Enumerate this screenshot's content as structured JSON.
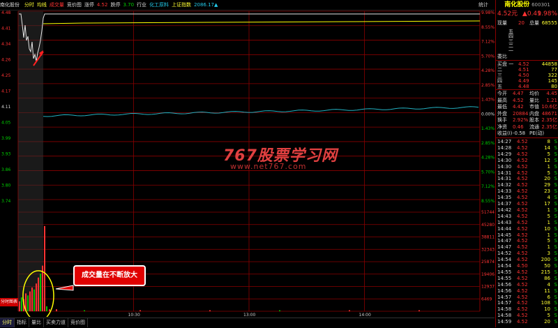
{
  "header": {
    "stock": "南化股份",
    "items": [
      {
        "label": "分时",
        "color": "#ffff33"
      },
      {
        "label": "均线",
        "color": "#ffff33"
      },
      {
        "label": "成交量",
        "color": "#ff3333"
      },
      {
        "label": "竞价图",
        "color": "#ddd"
      },
      {
        "label": "涨停",
        "color": "#ddd"
      },
      {
        "label": "4.52",
        "color": "#ff3333"
      },
      {
        "label": "跌停",
        "color": "#ddd"
      },
      {
        "label": "3.70",
        "color": "#00d000"
      },
      {
        "label": "行业",
        "color": "#ddd"
      },
      {
        "label": "化工原料",
        "color": "#22c8e8"
      },
      {
        "label": "上证指数",
        "color": "#ffff33"
      },
      {
        "label": "2086.17▲",
        "color": "#22c8e8"
      }
    ],
    "right_label": "统计"
  },
  "price_axis_left": [
    "4.48",
    "4.41",
    "4.34",
    "4.26",
    "4.25",
    "4.17",
    "4.11",
    "4.05",
    "3.99",
    "3.93",
    "3.86",
    "3.80",
    "3.74"
  ],
  "price_axis_right": [
    "9.98%",
    "8.55%",
    "7.12%",
    "5.70%",
    "4.28%",
    "2.85%",
    "1.43%",
    "0.00%",
    "1.43%",
    "2.85%",
    "4.28%",
    "5.70%",
    "7.12%",
    "8.55%"
  ],
  "volume_axis": [
    "51744",
    "45280",
    "38811",
    "32343",
    "25874",
    "19406",
    "12937",
    "6469"
  ],
  "time_axis": [
    "10:30",
    "13:00",
    "14:00"
  ],
  "watermark": {
    "line1": "767股票学习网",
    "line2": "www.net767.com"
  },
  "callout": "成交量在不断放大",
  "side_label": "分时图表",
  "bottom_tabs": [
    {
      "label": "分时",
      "active": true
    },
    {
      "label": "指标",
      "active": false
    },
    {
      "label": "量比",
      "active": false
    },
    {
      "label": "买卖力道",
      "active": false
    },
    {
      "label": "竞价图",
      "active": false
    }
  ],
  "quote": {
    "name": "南化股份",
    "code": "600301",
    "price": "4.52元",
    "change": "▲0.41",
    "pct": "9.98%",
    "xianliang_label": "现量",
    "xianliang": "20",
    "zongliang_label": "总量",
    "zongliang": "68555",
    "ask_labels": [
      "五",
      "四",
      "三",
      "二",
      "一"
    ],
    "weibi_label": "委比",
    "bids": [
      {
        "label": "买盘 一",
        "price": "4.52",
        "vol": "44858"
      },
      {
        "label": "二",
        "price": "4.51",
        "vol": "77"
      },
      {
        "label": "三",
        "price": "4.50",
        "vol": "322"
      },
      {
        "label": "四",
        "price": "4.49",
        "vol": "145"
      },
      {
        "label": "五",
        "price": "4.48",
        "vol": "80"
      }
    ],
    "stats": [
      {
        "l1": "今开",
        "v1": "4.47",
        "l2": "均价",
        "v2": "4.45"
      },
      {
        "l1": "最高",
        "v1": "4.52",
        "l2": "量比",
        "v2": "1.21"
      },
      {
        "l1": "最低",
        "v1": "4.42",
        "l2": "市值",
        "v2": "10.6亿"
      },
      {
        "l1": "外盘",
        "v1": "20884",
        "l2": "内盘",
        "v2": "48671"
      },
      {
        "l1": "换手",
        "v1": "2.92%",
        "l2": "股本",
        "v2": "2.35亿"
      },
      {
        "l1": "净资",
        "v1": "0.46",
        "l2": "流通",
        "v2": "2.35亿"
      },
      {
        "l1": "收益(I)",
        "v1": "-0.58",
        "l2": "PE(动)",
        "v2": ""
      }
    ]
  },
  "ticks": [
    {
      "t": "14:27",
      "p": "4.52",
      "v": "8",
      "s": "S"
    },
    {
      "t": "14:28",
      "p": "4.52",
      "v": "14",
      "s": "S"
    },
    {
      "t": "14:29",
      "p": "4.52",
      "v": "5",
      "s": "S"
    },
    {
      "t": "14:30",
      "p": "4.52",
      "v": "12",
      "s": "S"
    },
    {
      "t": "14:30",
      "p": "4.52",
      "v": "1",
      "s": "S"
    },
    {
      "t": "14:31",
      "p": "4.52",
      "v": "5",
      "s": "S"
    },
    {
      "t": "14:31",
      "p": "4.52",
      "v": "20",
      "s": "S"
    },
    {
      "t": "14:32",
      "p": "4.52",
      "v": "29",
      "s": "S"
    },
    {
      "t": "14:33",
      "p": "4.52",
      "v": "23",
      "s": "S"
    },
    {
      "t": "14:35",
      "p": "4.52",
      "v": "4",
      "s": "S"
    },
    {
      "t": "14:37",
      "p": "4.52",
      "v": "17",
      "s": "S"
    },
    {
      "t": "14:42",
      "p": "4.52",
      "v": "1",
      "s": "S"
    },
    {
      "t": "14:43",
      "p": "4.52",
      "v": "5",
      "s": "S"
    },
    {
      "t": "14:43",
      "p": "4.52",
      "v": "1",
      "s": "S"
    },
    {
      "t": "14:44",
      "p": "4.52",
      "v": "10",
      "s": "S"
    },
    {
      "t": "14:45",
      "p": "4.52",
      "v": "1",
      "s": "S"
    },
    {
      "t": "14:47",
      "p": "4.52",
      "v": "5",
      "s": "S"
    },
    {
      "t": "14:47",
      "p": "4.52",
      "v": "1",
      "s": "S"
    },
    {
      "t": "14:52",
      "p": "4.52",
      "v": "3",
      "s": "S"
    },
    {
      "t": "14:54",
      "p": "4.52",
      "v": "200",
      "s": "S"
    },
    {
      "t": "14:54",
      "p": "4.50",
      "v": "50",
      "s": "S"
    },
    {
      "t": "14:55",
      "p": "4.52",
      "v": "215",
      "s": "S"
    },
    {
      "t": "14:55",
      "p": "4.52",
      "v": "86",
      "s": "S"
    },
    {
      "t": "14:56",
      "p": "4.52",
      "v": "4",
      "s": "S"
    },
    {
      "t": "14:56",
      "p": "4.52",
      "v": "11",
      "s": "S"
    },
    {
      "t": "14:57",
      "p": "4.52",
      "v": "6",
      "s": "S"
    },
    {
      "t": "14:57",
      "p": "4.52",
      "v": "108",
      "s": "S"
    },
    {
      "t": "14:58",
      "p": "4.52",
      "v": "10",
      "s": "S"
    },
    {
      "t": "14:58",
      "p": "4.52",
      "v": "5",
      "s": "S"
    },
    {
      "t": "14:59",
      "p": "4.52",
      "v": "20",
      "s": "S"
    }
  ],
  "colors": {
    "grid": "#8b0000",
    "price_line": "#e8e8e8",
    "avg_line": "#ffff00",
    "index_line": "#22b0c0",
    "vol_up": "#ff3333",
    "vol_down": "#00c000"
  }
}
